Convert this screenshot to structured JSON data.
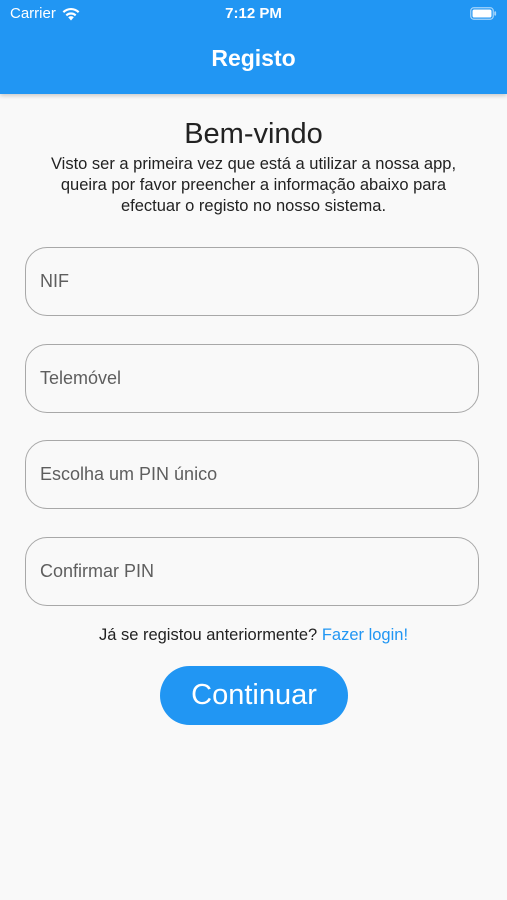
{
  "status_bar": {
    "carrier": "Carrier",
    "time": "7:12 PM"
  },
  "appbar": {
    "title": "Registo"
  },
  "welcome": {
    "title": "Bem-vindo",
    "line1": "Visto ser a primeira vez que está a utilizar a nossa app,",
    "line2": "queira por favor preencher a informação abaixo para",
    "line3": "efectuar o registo no nosso sistema."
  },
  "form": {
    "nif_placeholder": "NIF",
    "phone_placeholder": "Telemóvel",
    "pin_placeholder": "Escolha um PIN único",
    "confirm_pin_placeholder": "Confirmar PIN"
  },
  "login": {
    "prompt": "Já se registou anteriormente?",
    "link": "Fazer login!"
  },
  "continue_label": "Continuar",
  "colors": {
    "primary": "#2196f3",
    "background": "#f9f9f9",
    "border": "#a8a8a8"
  }
}
